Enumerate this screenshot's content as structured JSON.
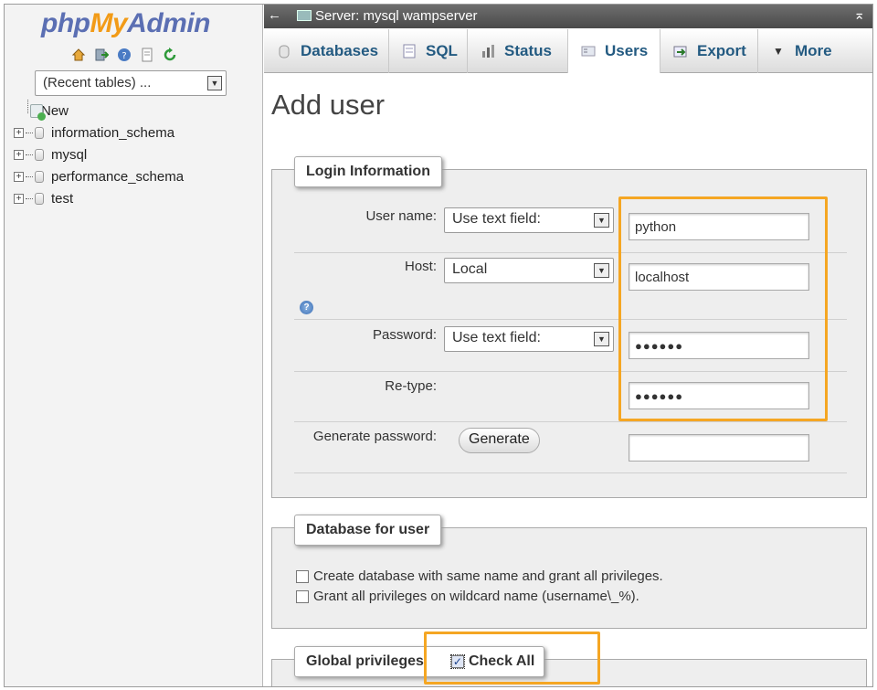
{
  "nav": {
    "logo_php": "php",
    "logo_my": "My",
    "logo_admin": "Admin",
    "icons": [
      "home-icon",
      "exit-icon",
      "help-icon",
      "docs-icon",
      "reload-icon"
    ],
    "recent_tables": "(Recent tables) ...",
    "new_label": "New",
    "databases": [
      "information_schema",
      "mysql",
      "performance_schema",
      "test"
    ]
  },
  "topbar": {
    "back": "←",
    "server": "Server: mysql wampserver",
    "collapse": "⌅"
  },
  "tabs": [
    {
      "label": "Databases",
      "icon": "database-icon"
    },
    {
      "label": "SQL",
      "icon": "sql-icon"
    },
    {
      "label": "Status",
      "icon": "status-icon"
    },
    {
      "label": "Users",
      "icon": "users-icon"
    },
    {
      "label": "Export",
      "icon": "export-icon"
    },
    {
      "label": "More",
      "icon": "chevron-down-icon"
    }
  ],
  "page_title": "Add user",
  "login": {
    "legend": "Login Information",
    "username_label": "User name:",
    "username_mode": "Use text field:",
    "username_value": "python",
    "host_label": "Host:",
    "host_mode": "Local",
    "host_value": "localhost",
    "password_label": "Password:",
    "password_mode": "Use text field:",
    "password_value": "●●●●●●",
    "retype_label": "Re-type:",
    "retype_value": "●●●●●●",
    "generate_label": "Generate password:",
    "generate_button": "Generate",
    "generated_value": ""
  },
  "dbforuser": {
    "legend": "Database for user",
    "options": [
      "Create database with same name and grant all privileges.",
      "Grant all privileges on wildcard name (username\\_%)."
    ]
  },
  "global": {
    "legend": "Global privileges",
    "check_all": "Check All"
  },
  "colors": {
    "highlight": "#f5a623",
    "tab_text": "#235a81",
    "logo_blue": "#5b6fb3",
    "logo_orange": "#f29b17"
  }
}
